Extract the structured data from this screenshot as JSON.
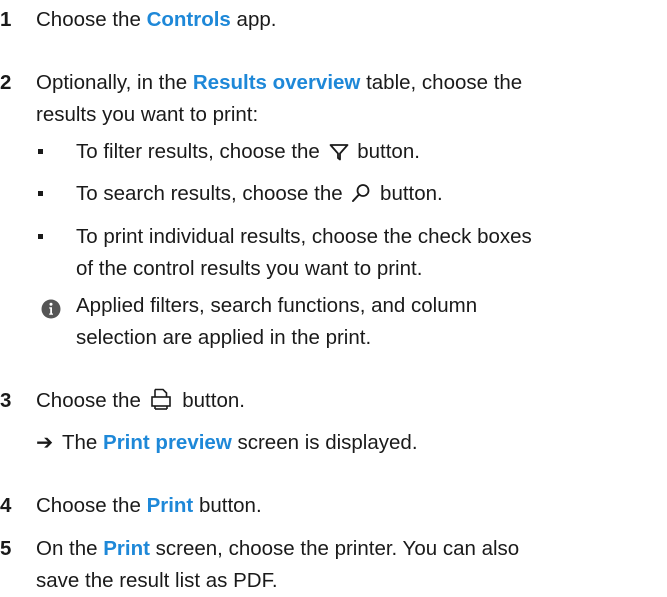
{
  "steps": [
    {
      "num": "1",
      "pre": "Choose the ",
      "hl": "Controls",
      "post": " app."
    },
    {
      "num": "2",
      "pre": "Optionally, in the ",
      "hl": "Results overview",
      "post": " table, choose the",
      "line2": "results you want to print:",
      "bullets": [
        {
          "pre": "To filter results, choose the ",
          "icon": "filter-icon",
          "post": " button."
        },
        {
          "pre": "To search results, choose the ",
          "icon": "search-icon",
          "post": " button."
        },
        {
          "line1": "To print individual results, choose the check boxes",
          "line2": "of the control results you want to print."
        }
      ],
      "info": {
        "icon": "info-icon",
        "line1": "Applied filters, search functions, and column",
        "line2": "selection are applied in the print."
      }
    },
    {
      "num": "3",
      "pre": "Choose the ",
      "icon": "print-icon",
      "post": " button.",
      "result": {
        "arrow": "➔",
        "pre": "The ",
        "hl": "Print preview",
        "post": " screen is displayed."
      }
    },
    {
      "num": "4",
      "pre": "Choose the ",
      "hl": "Print",
      "post": " button."
    },
    {
      "num": "5",
      "pre": "On the ",
      "hl": "Print",
      "post": " screen, choose the printer. You can also",
      "line2": "save the result list as PDF."
    }
  ],
  "colors": {
    "highlight": "#1e88d8",
    "text": "#1a1a1a"
  }
}
